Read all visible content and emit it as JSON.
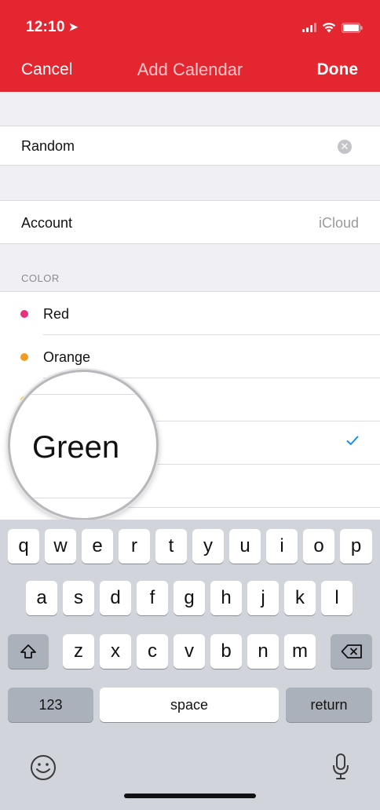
{
  "status": {
    "time": "12:10",
    "location_icon": "location-arrow-icon",
    "signal_icon": "signal-icon",
    "wifi_icon": "wifi-icon",
    "battery_icon": "battery-icon"
  },
  "nav": {
    "cancel": "Cancel",
    "title": "Add Calendar",
    "done": "Done"
  },
  "name_field": {
    "value": "Random",
    "clear_icon": "clear-icon"
  },
  "account": {
    "label": "Account",
    "value": "iCloud"
  },
  "color_section": {
    "label": "COLOR",
    "items": [
      {
        "name": "Red",
        "color": "#e8317a"
      },
      {
        "name": "Orange",
        "color": "#f29b22"
      },
      {
        "name": "",
        "color": "#f6cd2f"
      },
      {
        "name": "Green",
        "color": "#2ec55a",
        "selected": true
      },
      {
        "name": "",
        "color": "#1a8cf0"
      }
    ]
  },
  "magnifier": {
    "text": "Green"
  },
  "keyboard": {
    "row1": [
      "q",
      "w",
      "e",
      "r",
      "t",
      "y",
      "u",
      "i",
      "o",
      "p"
    ],
    "row2": [
      "a",
      "s",
      "d",
      "f",
      "g",
      "h",
      "j",
      "k",
      "l"
    ],
    "row3": [
      "z",
      "x",
      "c",
      "v",
      "b",
      "n",
      "m"
    ],
    "shift_icon": "shift-icon",
    "delete_icon": "delete-icon",
    "numbers_label": "123",
    "space_label": "space",
    "return_label": "return",
    "emoji_icon": "emoji-icon",
    "mic_icon": "microphone-icon"
  },
  "colors": {
    "header": "#e3262f",
    "check": "#1a8cf0",
    "keyboard_bg": "#d1d4db"
  }
}
